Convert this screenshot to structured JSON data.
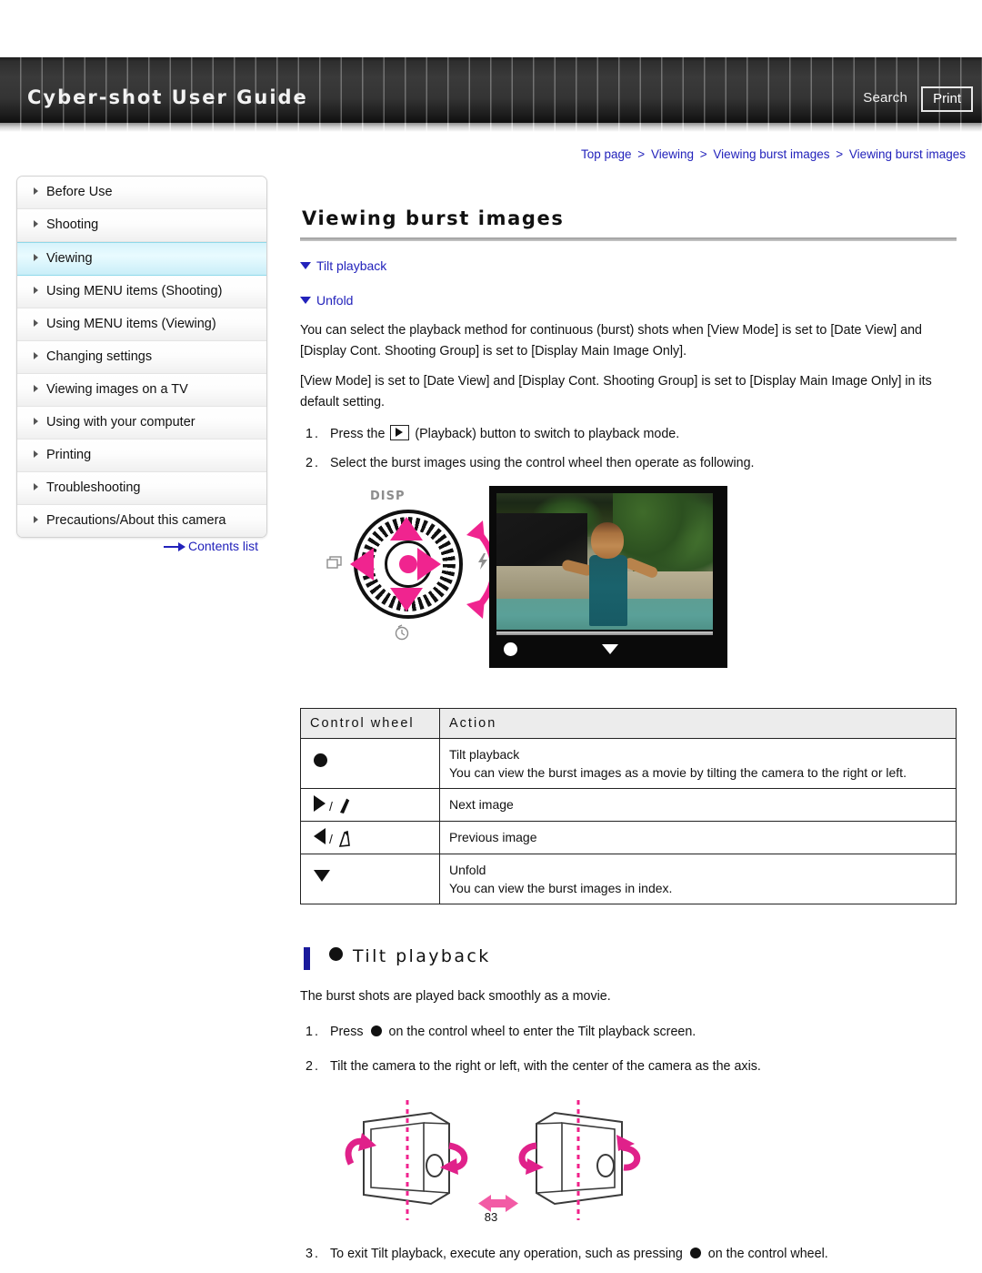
{
  "header": {
    "brand": "Cyber-shot User Guide",
    "search_label": "Search",
    "print_label": "Print"
  },
  "breadcrumb": {
    "items": [
      "Top page",
      "Viewing",
      "Viewing burst images",
      "Viewing burst images"
    ],
    "separator": ">"
  },
  "sidebar": {
    "items": [
      {
        "label": "Before Use",
        "active": false
      },
      {
        "label": "Shooting",
        "active": false
      },
      {
        "label": "Viewing",
        "active": true
      },
      {
        "label": "Using MENU items (Shooting)",
        "active": false
      },
      {
        "label": "Using MENU items (Viewing)",
        "active": false
      },
      {
        "label": "Changing settings",
        "active": false
      },
      {
        "label": "Viewing images on a TV",
        "active": false
      },
      {
        "label": "Using with your computer",
        "active": false
      },
      {
        "label": "Printing",
        "active": false
      },
      {
        "label": "Troubleshooting",
        "active": false
      },
      {
        "label": "Precautions/About this camera",
        "active": false
      }
    ],
    "contents_link": "Contents list"
  },
  "main": {
    "title": "Viewing burst images",
    "jump_links": [
      "Tilt playback",
      "Unfold"
    ],
    "para1": "You can select the playback method for continuous (burst) shots when [View Mode] is set to [Date View] and [Display Cont. Shooting Group] is set to [Display Main Image Only].",
    "para2": "[View Mode] is set to [Date View] and [Display Cont. Shooting Group] is set to [Display Main Image Only] in its default setting.",
    "step1_num": "1.",
    "step1_pre": "Press the",
    "step1_post": "(Playback) button to switch to playback mode.",
    "step2_num": "2.",
    "step2_text": "Select the burst images using the control wheel then operate as following.",
    "wheel_labels": {
      "disp": "DISP",
      "burst": "burst-mode-icon",
      "flash": "flash-icon",
      "timer": "self-timer-icon"
    },
    "table": {
      "headers": [
        "Control wheel",
        "Action"
      ],
      "rows": [
        {
          "symbol": "center-button",
          "lines": [
            "Tilt playback",
            "You can view the burst images as a movie by tilting the camera to the right or left."
          ]
        },
        {
          "symbol": "right-and-tilt-right",
          "lines": [
            "Next image"
          ]
        },
        {
          "symbol": "left-and-tilt-left",
          "lines": [
            "Previous image"
          ]
        },
        {
          "symbol": "down-button",
          "lines": [
            "Unfold",
            "You can view the burst images in index."
          ]
        }
      ]
    },
    "section": {
      "heading": "Tilt playback",
      "intro": "The burst shots are played back smoothly as a movie.",
      "step1_num": "1.",
      "step1_pre": "Press",
      "step1_post": "on the control wheel to enter the Tilt playback screen.",
      "step2_num": "2.",
      "step2_text": "Tilt the camera to the right or left, with the center of the camera as the axis.",
      "step3_num": "3.",
      "step3_pre": "To exit Tilt playback, execute any operation, such as pressing",
      "step3_post": "on the control wheel."
    }
  },
  "footer": {
    "page_number": "83"
  },
  "colors": {
    "link": "#2222bb",
    "accent_pink": "#f0248f",
    "heading_bar": "#1a1a9c",
    "active_nav": "#d6f3fb"
  }
}
